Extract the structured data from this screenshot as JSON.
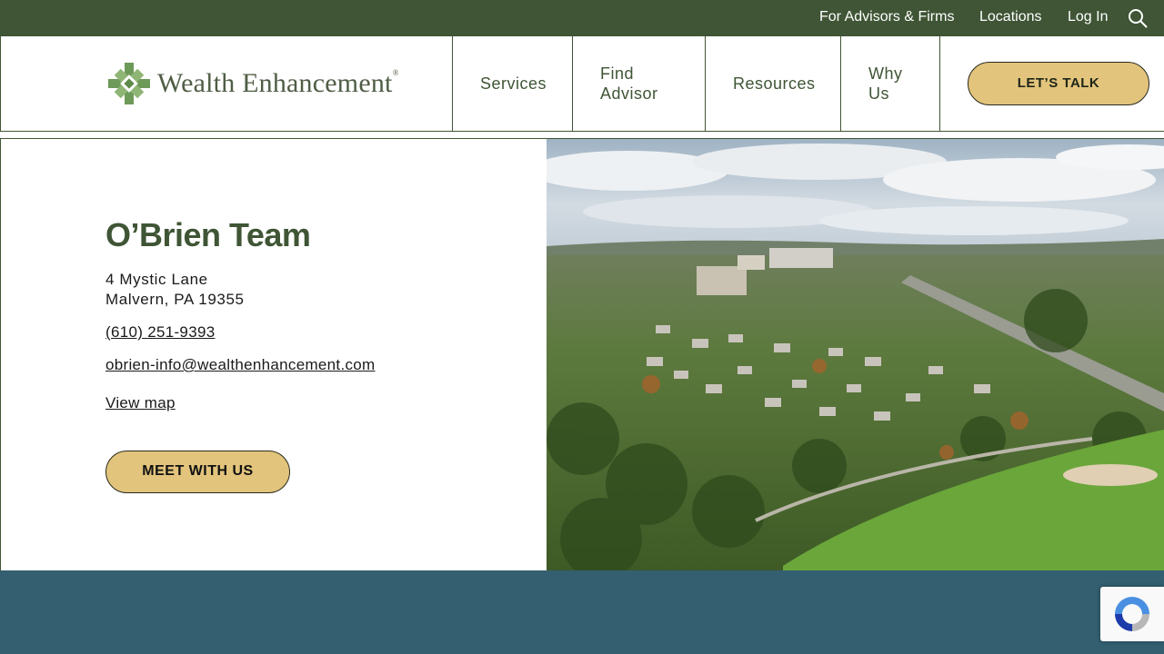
{
  "topbar": {
    "links": [
      "For Advisors & Firms",
      "Locations",
      "Log In"
    ],
    "search_icon": "search-icon"
  },
  "header": {
    "logo_text": "Wealth Enhancement",
    "logo_mark": "®",
    "nav": {
      "services": "Services",
      "find_advisor_1": "Find",
      "find_advisor_2": "Advisor",
      "resources": "Resources",
      "why_us_1": "Why",
      "why_us_2": "Us"
    },
    "cta": "LET’S TALK"
  },
  "location": {
    "name": "O’Brien Team",
    "address_line1": "4 Mystic Lane",
    "address_line2": "Malvern, PA 19355",
    "phone": "(610) 251-9393",
    "email": "obrien-info@wealthenhancement.com",
    "map_link": "View map",
    "cta": "MEET WITH US"
  },
  "colors": {
    "brand_green": "#3f5535",
    "accent_gold": "#e2c47c",
    "footer_teal": "#335f70"
  }
}
